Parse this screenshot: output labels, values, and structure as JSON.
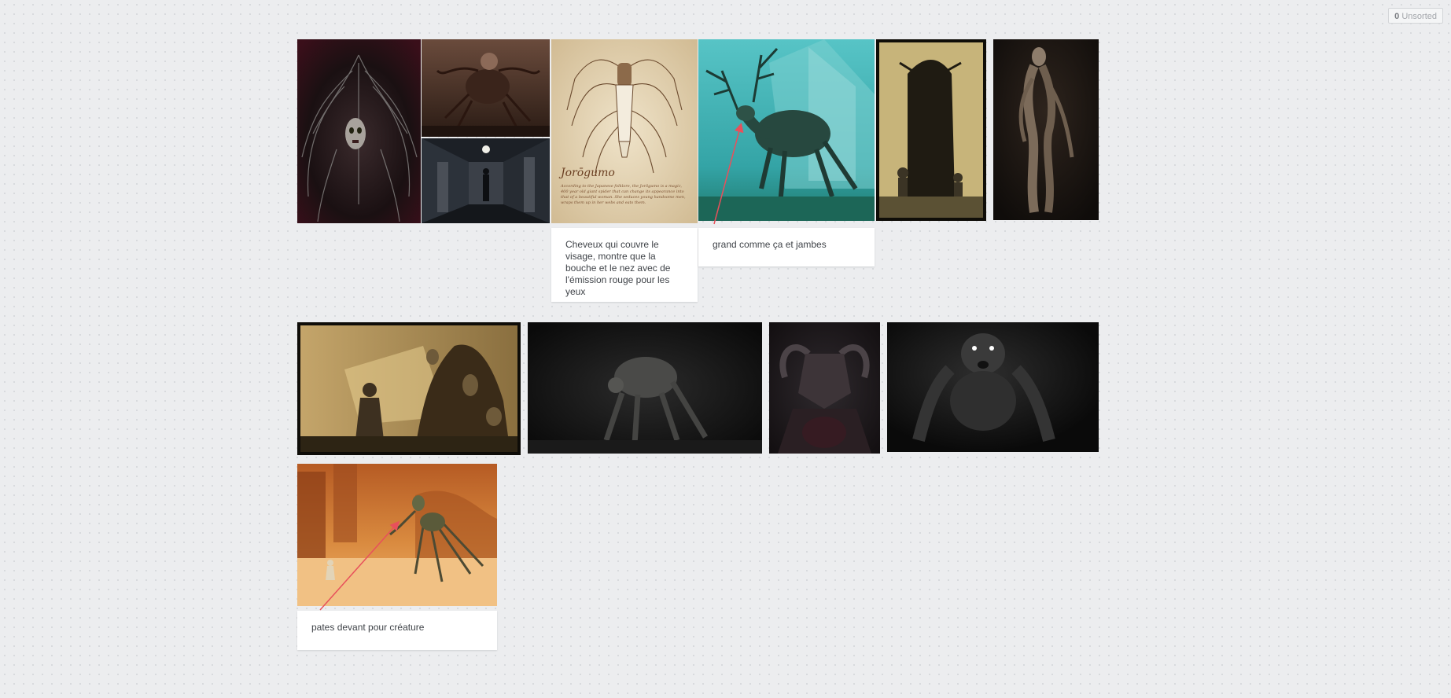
{
  "topbar": {
    "unsorted_count": "0",
    "unsorted_label": "Unsorted"
  },
  "colors": {
    "board_bg": "#ecedef",
    "note_bg": "#ffffff",
    "note_text": "#3f4348",
    "arrow": "#e8505b"
  },
  "cards": {
    "jorogumo_title": "Jorōgumo",
    "jorogumo_text": "According to the Japanese folklore, the Jorōgumo is a magic, 400 year old giant spider that can change its appearance into that of a beautiful woman. She seduces young handsome men, wraps them up in her webs and eats them."
  },
  "notes": {
    "hair_note": "Cheveux qui couvre le visage, montre que la bouche et le nez avec de l'émission rouge pour les yeux",
    "size_note": "grand comme ça et jambes",
    "legs_note": "pates devant pour créature"
  },
  "images": [
    {
      "subject": "spine-face creature illustration"
    },
    {
      "subject": "crawling hairy creature"
    },
    {
      "subject": "dark hallway with figure"
    },
    {
      "subject": "jorogumo spider illustration"
    },
    {
      "subject": "antlered creature by house"
    },
    {
      "subject": "tall cloaked figure with children"
    },
    {
      "subject": "pale thin standing figure"
    },
    {
      "subject": "figure with lantern and tree monster"
    },
    {
      "subject": "hunched crawling figure in dark"
    },
    {
      "subject": "horned demon bust"
    },
    {
      "subject": "glowing-eyed creature in dark"
    },
    {
      "subject": "arena mantis creature"
    }
  ]
}
